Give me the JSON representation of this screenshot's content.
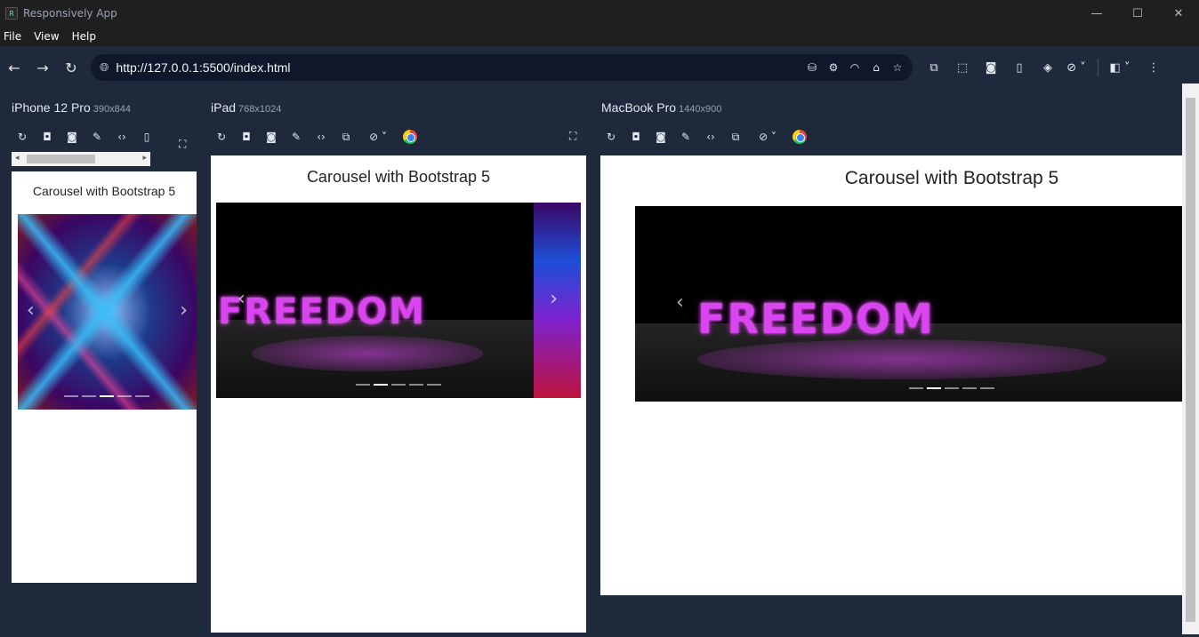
{
  "window": {
    "title": "Responsively App",
    "min": "—",
    "max": "☐",
    "close": "✕"
  },
  "menu": [
    "File",
    "View",
    "Help"
  ],
  "address": {
    "url": "http://127.0.0.1:5500/index.html"
  },
  "devices": [
    {
      "name": "iPhone 12 Pro",
      "size": "390x844"
    },
    {
      "name": "iPad",
      "size": "768x1024"
    },
    {
      "name": "MacBook Pro",
      "size": "1440x900"
    }
  ],
  "page": {
    "heading": "Carousel with Bootstrap 5",
    "banner_text": "FREEDOM"
  },
  "icons": {
    "back": "back-arrow-icon",
    "forward": "forward-arrow-icon",
    "reload": "reload-icon",
    "globe": "globe-icon",
    "bookmark": "star-icon",
    "home": "home-icon"
  }
}
